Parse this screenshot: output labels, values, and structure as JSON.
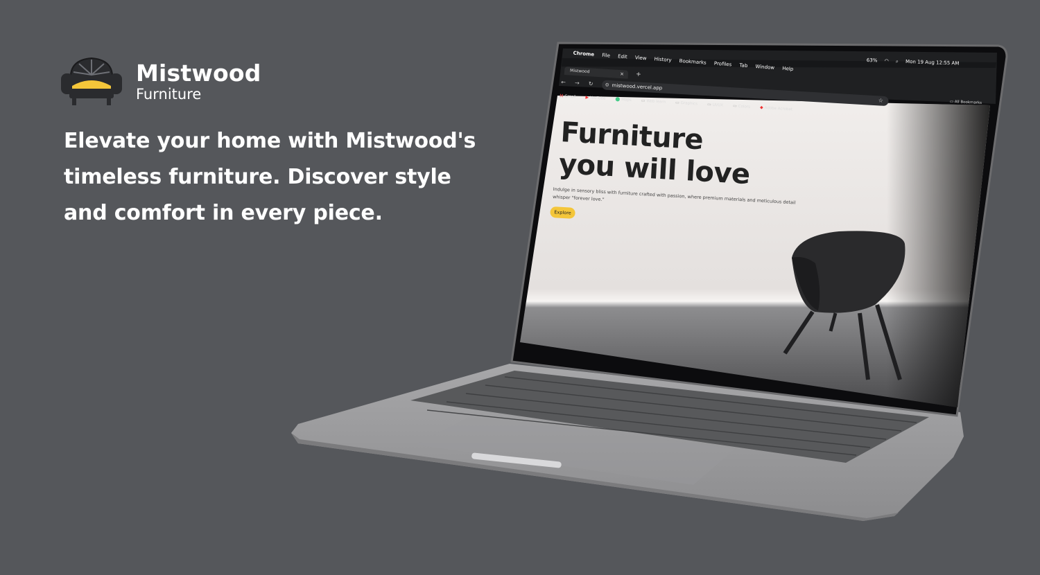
{
  "brand": {
    "name": "Mistwood",
    "subtitle": "Furniture"
  },
  "headline": "Elevate your home with Mistwood's timeless furniture. Discover style and comfort in every piece.",
  "colors": {
    "background": "#55575b",
    "accent": "#f4c63a",
    "text": "#ffffff"
  },
  "laptop_screen": {
    "menubar": {
      "items": [
        "Chrome",
        "File",
        "Edit",
        "View",
        "History",
        "Bookmarks",
        "Profiles",
        "Tab",
        "Window",
        "Help"
      ],
      "battery": "63%",
      "datetime": "Mon 19 Aug  12:55 AM"
    },
    "tab": {
      "title": "Mistwood"
    },
    "url": "mistwood.vercel.app",
    "bookmarks": [
      "Gmail",
      "YouTube",
      "Maps",
      "Web learn",
      "Graphics",
      "UI/UX",
      "Colors",
      "Adobe Acrobat"
    ],
    "all_bookmarks": "All Bookmarks",
    "page": {
      "headline_line1": "Furniture",
      "headline_line2": "you will love",
      "description": "Indulge in sensory bliss with furniture crafted with passion, where premium materials and meticulous detail whisper \"forever love.\"",
      "button": "Explore"
    }
  }
}
